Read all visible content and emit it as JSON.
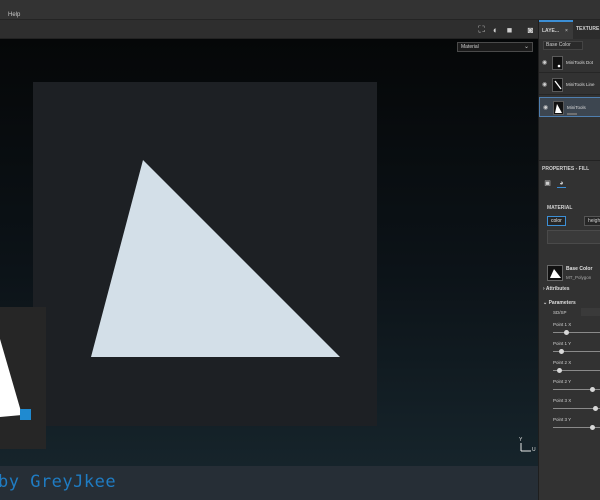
{
  "menubar": {
    "help": "Help"
  },
  "viewport": {
    "material_select": "Material",
    "axis_y": "Y",
    "axis_u": "U",
    "watermark": "by GreyJkee"
  },
  "panel": {
    "tabs": [
      {
        "label": "LAYE..."
      },
      {
        "label": "TEXTURE S"
      }
    ],
    "close": "×",
    "channel": "Base Color",
    "layers": [
      {
        "name": "MiniTools Dot",
        "visible": true,
        "selected": false
      },
      {
        "name": "MiniTools Line",
        "visible": true,
        "selected": false
      },
      {
        "name": "MiniTools",
        "visible": true,
        "selected": true
      }
    ],
    "properties_title": "PROPERTIES - FILL",
    "material_title": "MATERIAL",
    "chips": {
      "color": "color",
      "height": "height"
    },
    "base_color_title": "Base Color",
    "base_color_sub": "MT_Polygon",
    "attributes": "Attributes",
    "parameters": "Parameters",
    "sdsp": "SD/SP",
    "params": [
      {
        "label": "Point 1 X",
        "value": 0.28
      },
      {
        "label": "Point 1 Y",
        "value": 0.17
      },
      {
        "label": "Point 2 X",
        "value": 0.12
      },
      {
        "label": "Point 2 Y",
        "value": 0.82
      },
      {
        "label": "Point 3 X",
        "value": 0.87
      },
      {
        "label": "Point 3 Y",
        "value": 0.82
      }
    ]
  },
  "colors": {
    "triangle": "#d3dfe8",
    "accent": "#1f7cc3",
    "canvas": "#1d2024"
  }
}
